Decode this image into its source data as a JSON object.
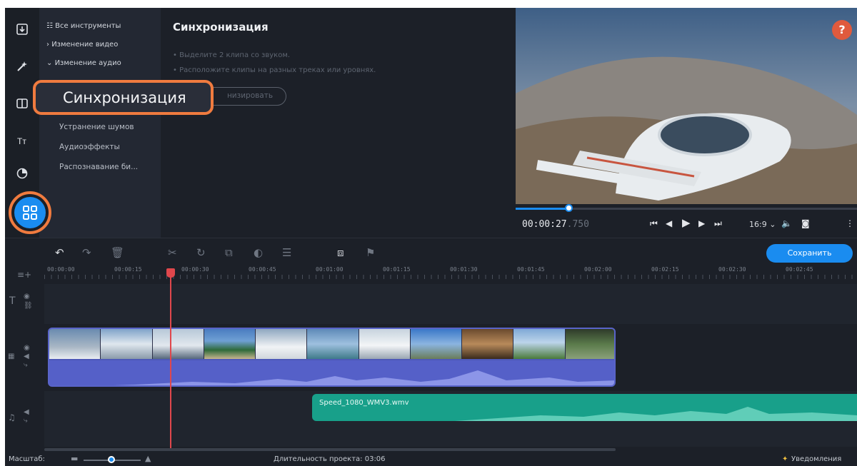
{
  "tools_menu": {
    "all_tools": "Все инструменты",
    "edit_video": "Изменение видео",
    "edit_audio": "Изменение аудио",
    "sub_items": [
      "Устранение шумов",
      "Аудиоэффекты",
      "Распознавание би..."
    ]
  },
  "sync_panel": {
    "title": "Синхронизация",
    "hints": [
      "• Выделите 2 клипа со звуком.",
      "• Расположите клипы на разных треках или уровнях."
    ],
    "button_visible": "низировать"
  },
  "callout": {
    "label": "Синхронизация"
  },
  "preview": {
    "help": "?",
    "timecode_main": "00:00:27",
    "timecode_ms": ".750",
    "aspect_ratio": "16:9 ⌄",
    "progress_fraction": 0.16
  },
  "timeline": {
    "save_label": "Сохранить",
    "ruler_labels": [
      "00:00:00",
      "00:00:15",
      "00:00:30",
      "00:00:45",
      "00:01:00",
      "00:01:15",
      "00:01:30",
      "00:01:45",
      "00:02:00",
      "00:02:15",
      "00:02:30",
      "00:02:45"
    ],
    "audio_clip_name": "Speed_1080_WMV3.wmv"
  },
  "status_bar": {
    "scale_label": "Масштаб:",
    "duration_label": "Длительность проекта: 03:06",
    "notifications": "Уведомления"
  },
  "colors": {
    "accent": "#1a8cf0",
    "highlight": "#f07b3f",
    "playhead": "#e0474c",
    "audio_clip": "#18a08a",
    "video_clip": "#4d58b8"
  }
}
